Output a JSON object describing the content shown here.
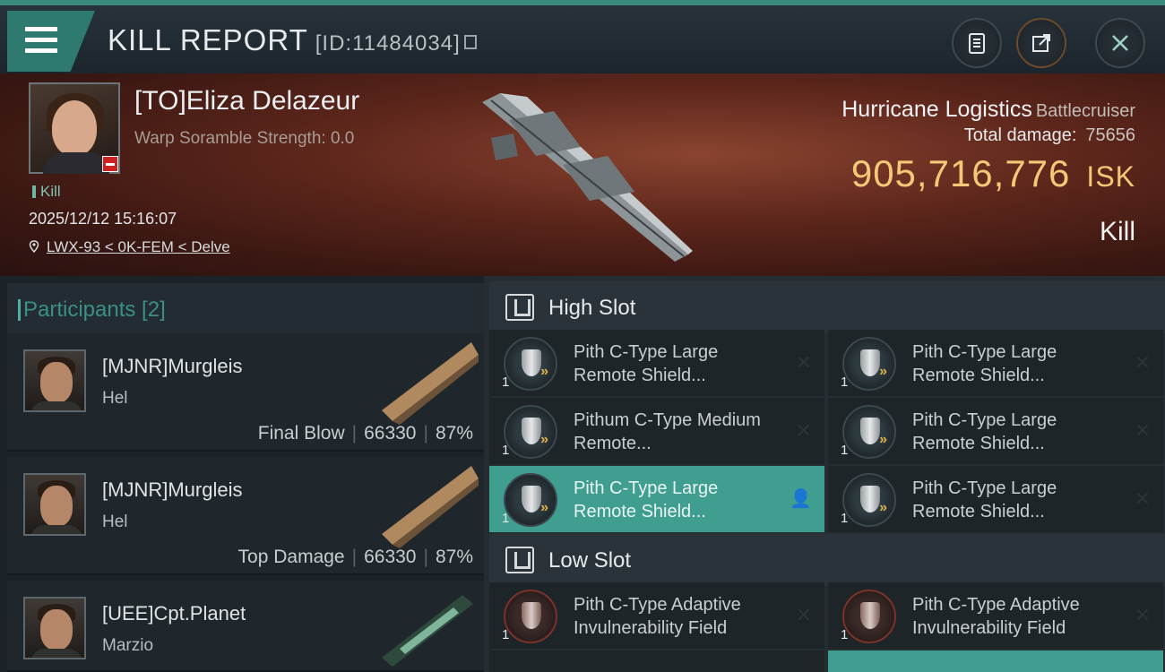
{
  "header": {
    "title": "KILL REPORT",
    "id_text": "[ID:11484034]"
  },
  "victim": {
    "name": "[TO]Eliza Delazeur",
    "warp_scramble": "Warp Soramble Strength: 0.0",
    "tag": "Kill",
    "datetime": "2025/12/12 15:16:07",
    "location": "LWX-93 < 0K-FEM < Delve",
    "ship_name": "Hurricane Logistics",
    "ship_class": "Battlecruiser",
    "total_damage_label": "Total damage:",
    "total_damage_value": "75656",
    "isk_value": "905,716,776",
    "isk_unit": "ISK",
    "result": "Kill"
  },
  "participants": {
    "title": "Participants [2]",
    "rows": [
      {
        "name": "[MJNR]Murgleis",
        "ship": "Hel",
        "stat_label": "Final Blow",
        "damage": "66330",
        "percent": "87%"
      },
      {
        "name": "[MJNR]Murgleis",
        "ship": "Hel",
        "stat_label": "Top Damage",
        "damage": "66330",
        "percent": "87%"
      },
      {
        "name": "[UEE]Cpt.Planet",
        "ship": "Marzio",
        "stat_label": "",
        "damage": "",
        "percent": ""
      }
    ]
  },
  "fittings": {
    "high_slot": {
      "label": "High Slot",
      "modules": [
        {
          "name": "Pith C-Type Large Remote Shield...",
          "qty": "1"
        },
        {
          "name": "Pith C-Type Large Remote Shield...",
          "qty": "1"
        },
        {
          "name": "Pithum C-Type Medium Remote...",
          "qty": "1"
        },
        {
          "name": "Pith C-Type Large Remote Shield...",
          "qty": "1"
        },
        {
          "name": "Pith C-Type Large Remote Shield...",
          "qty": "1"
        },
        {
          "name": "Pith C-Type Large Remote Shield...",
          "qty": "1"
        }
      ]
    },
    "low_slot": {
      "label": "Low Slot",
      "modules": [
        {
          "name": "Pith C-Type Adaptive Invulnerability Field",
          "qty": "1"
        },
        {
          "name": "Pith C-Type Adaptive Invulnerability Field",
          "qty": "1"
        }
      ]
    }
  },
  "colors": {
    "accent": "#3f9e90",
    "isk": "#f3c877",
    "banner": "#5c261b"
  }
}
